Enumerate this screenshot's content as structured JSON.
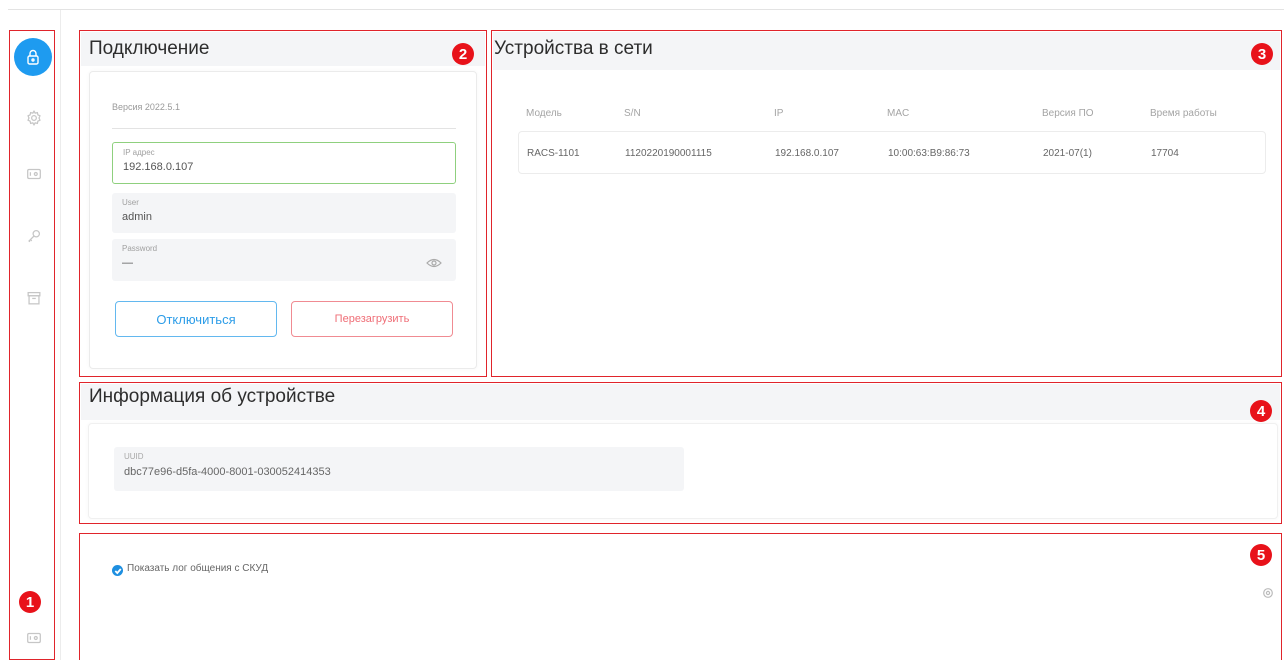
{
  "sidebar": {
    "badge": "1",
    "items": [
      {
        "icon": "lock-icon",
        "active": true
      },
      {
        "icon": "gear-icon",
        "active": false
      },
      {
        "icon": "card-reader-icon",
        "active": false
      },
      {
        "icon": "key-icon",
        "active": false
      },
      {
        "icon": "archive-icon",
        "active": false
      }
    ],
    "bottom_icon": "card-reader-icon"
  },
  "connection": {
    "badge": "2",
    "title": "Подключение",
    "version": "Версия 2022.5.1",
    "ip": {
      "label": "IP адрес",
      "value": "192.168.0.107"
    },
    "user": {
      "label": "User",
      "value": "admin"
    },
    "password": {
      "label": "Password",
      "value": "—"
    },
    "disconnect_label": "Отключиться",
    "restart_label": "Перезагрузить"
  },
  "devices": {
    "badge": "3",
    "title": "Устройства в сети",
    "columns": [
      "Модель",
      "S/N",
      "IP",
      "MAC",
      "Версия ПО",
      "Время работы"
    ],
    "rows": [
      [
        "RACS-1101",
        "1120220190001115",
        "192.168.0.107",
        "10:00:63:B9:86:73",
        "2021-07(1)",
        "17704"
      ]
    ]
  },
  "device_info": {
    "badge": "4",
    "title": "Информация об устройстве",
    "uuid_label": "UUID",
    "uuid_value": "dbc77e96-d5fa-4000-8001-030052414353"
  },
  "log": {
    "badge": "5",
    "checkbox_label": "Показать лог общения с СКУД",
    "checked": true
  },
  "colors": {
    "accent": "#1e9bf0",
    "annotation": "#e0242b",
    "focus_border": "#8fd07e",
    "danger": "#ef6d76"
  }
}
